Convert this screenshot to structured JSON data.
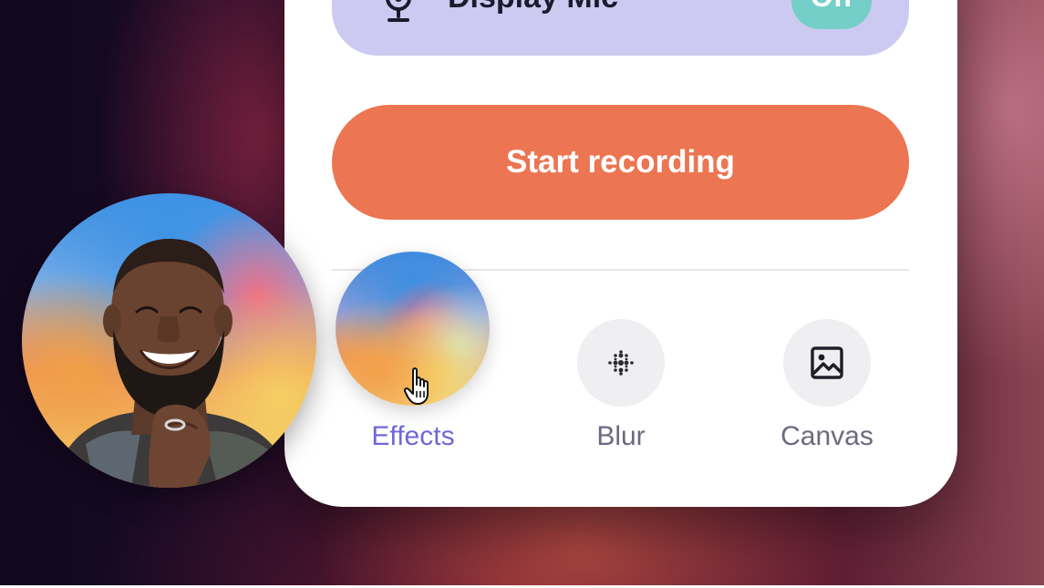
{
  "mic": {
    "label": "Display Mic",
    "toggle_label": "Off",
    "icon": "webcam-icon"
  },
  "record_button": {
    "label": "Start recording",
    "color": "#ec7552"
  },
  "options": [
    {
      "label": "Effects",
      "icon": "effects-gradient",
      "selected": true
    },
    {
      "label": "Blur",
      "icon": "blur-dots-icon",
      "selected": false
    },
    {
      "label": "Canvas",
      "icon": "image-icon",
      "selected": false
    }
  ],
  "colors": {
    "accent": "#6f67d8",
    "mic_row": "#cccaf0",
    "toggle": "#74cfc8"
  },
  "avatar": {
    "icon": "user-avatar"
  }
}
